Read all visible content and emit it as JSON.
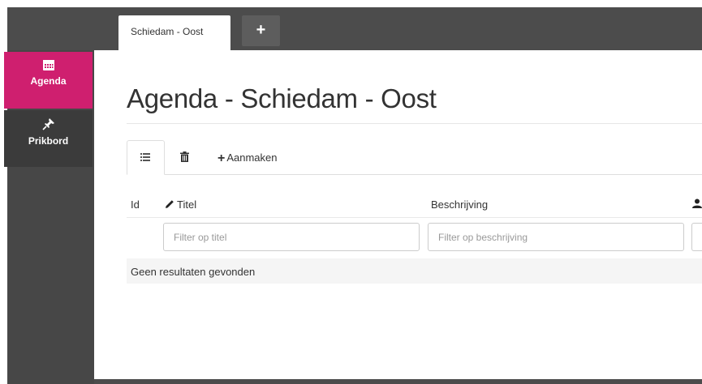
{
  "tabs": {
    "active_label": "Schiedam - Oost",
    "add_label": "+"
  },
  "sidebar": {
    "items": [
      {
        "label": "Agenda",
        "icon": "calendar-icon",
        "active": true
      },
      {
        "label": "Prikbord",
        "icon": "pin-icon",
        "active": false
      }
    ]
  },
  "main": {
    "title": "Agenda - Schiedam - Oost",
    "toolbar": {
      "list_icon": "list-icon",
      "trash_icon": "trash-icon",
      "create_label": "Aanmaken"
    },
    "table": {
      "columns": [
        "Id",
        "Titel",
        "Beschrijving"
      ],
      "filters": {
        "title_placeholder": "Filter op titel",
        "description_placeholder": "Filter op beschrijving"
      },
      "empty_message": "Geen resultaten gevonden"
    }
  },
  "colors": {
    "accent": "#cf1f6f",
    "sidebar": "#474747",
    "topbar": "#4c4c4c"
  }
}
